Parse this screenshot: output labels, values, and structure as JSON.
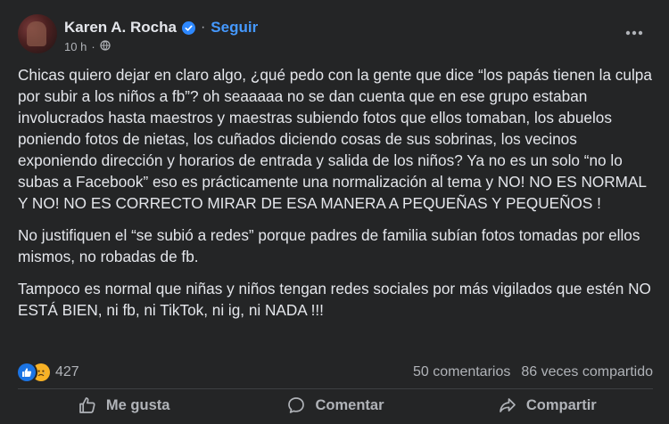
{
  "post": {
    "author": "Karen A. Rocha",
    "separator": "·",
    "follow_label": "Seguir",
    "time": "10 h",
    "time_separator": "·",
    "icons": {
      "verified": "verified-badge-icon",
      "audience": "globe-icon",
      "more": "more-options-icon"
    },
    "paragraphs": [
      "Chicas quiero dejar en claro algo, ¿qué pedo con la gente que dice “los papás tienen la culpa por subir a los niños a fb”? oh seaaaaa no se dan cuenta que en ese grupo estaban involucrados hasta maestros y maestras subiendo fotos que ellos tomaban, los abuelos poniendo fotos de nietas, los cuñados diciendo cosas de sus sobrinas, los vecinos exponiendo dirección y horarios de entrada y salida de los niños? Ya no es un solo “no lo subas a Facebook” eso es prácticamente una normalización al tema y NO! NO ES NORMAL Y NO! NO ES CORRECTO MIRAR DE ESA MANERA A PEQUEÑAS Y PEQUEÑOS !",
      "No justifiquen el “se subió a redes” porque padres de familia subían fotos tomadas por ellos mismos, no robadas de fb.",
      "Tampoco es normal que niñas y niños tengan redes sociales por más vigilados que estén NO ESTÁ BIEN, ni fb, ni TikTok, ni ig, ni NADA !!!"
    ]
  },
  "stats": {
    "reactions": [
      "like",
      "sad"
    ],
    "reaction_count": "427",
    "comments": "50 comentarios",
    "shares": "86 veces compartido"
  },
  "actions": {
    "like_label": "Me gusta",
    "comment_label": "Comentar",
    "share_label": "Compartir"
  },
  "colors": {
    "background": "#242526",
    "text": "#e4e6eb",
    "secondary": "#b0b3b8",
    "link": "#4599ff",
    "like": "#1b74e4",
    "sad": "#f7b125"
  }
}
